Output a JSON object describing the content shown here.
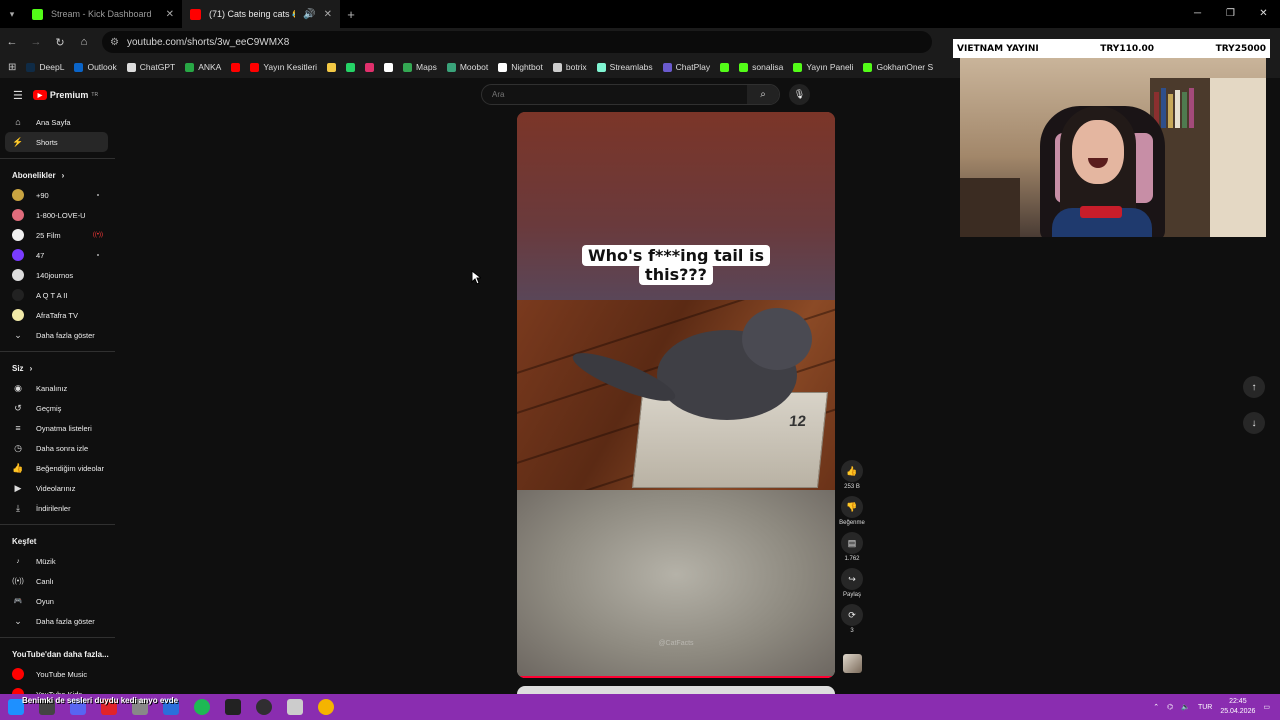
{
  "browser": {
    "tabs": [
      {
        "title": "Stream - Kick Dashboard",
        "active": false,
        "favicon_color": "#53fc18"
      },
      {
        "title": "(71) Cats being cats 😂🔥#",
        "active": true,
        "favicon_color": "#ff0000"
      }
    ],
    "new_tab": "+",
    "url": "youtube.com/shorts/3w_eeC9WMX8",
    "bookmarks": [
      {
        "label": "DeepL",
        "color": "#0f2b46"
      },
      {
        "label": "Outlook",
        "color": "#0a64c8"
      },
      {
        "label": "ChatGPT",
        "color": "#dddddd"
      },
      {
        "label": "ANKA",
        "color": "#28a745"
      },
      {
        "label": "",
        "color": "#ff0000"
      },
      {
        "label": "Yayın Kesitleri",
        "color": "#ff0000"
      },
      {
        "label": "",
        "color": "#f3c945"
      },
      {
        "label": "",
        "color": "#25d366"
      },
      {
        "label": "",
        "color": "#e1306c"
      },
      {
        "label": "",
        "color": "#ffffff"
      },
      {
        "label": "Maps",
        "color": "#34a853"
      },
      {
        "label": "Moobot",
        "color": "#3aa37a"
      },
      {
        "label": "Nightbot",
        "color": "#ffffff"
      },
      {
        "label": "botrix",
        "color": "#cccccc"
      },
      {
        "label": "Streamlabs",
        "color": "#80f5d2"
      },
      {
        "label": "ChatPlay",
        "color": "#6a5acd"
      },
      {
        "label": "",
        "color": "#53fc18"
      },
      {
        "label": "sonalisa",
        "color": "#53fc18"
      },
      {
        "label": "Yayın Paneli",
        "color": "#53fc18"
      },
      {
        "label": "GokhanOner S",
        "color": "#53fc18"
      }
    ]
  },
  "youtube": {
    "brand": "Premium",
    "brand_sup": "TR",
    "search_placeholder": "Ara",
    "main_nav": [
      {
        "label": "Ana Sayfa",
        "icon": "home-icon",
        "glyph": "⌂",
        "selected": false
      },
      {
        "label": "Shorts",
        "icon": "shorts-icon",
        "glyph": "⚡",
        "selected": true
      }
    ],
    "subscriptions_title": "Abonelikler",
    "subscriptions": [
      {
        "label": "+90",
        "color": "#c9a441",
        "indicator": "dot"
      },
      {
        "label": "1-800-LOVE-U",
        "color": "#e06c7c",
        "indicator": ""
      },
      {
        "label": "25 Film",
        "color": "#f0f0f0",
        "indicator": "live"
      },
      {
        "label": "47",
        "color": "#7a3cff",
        "indicator": "dot"
      },
      {
        "label": "140journos",
        "color": "#dddddd",
        "indicator": ""
      },
      {
        "label": "A Q T A II",
        "color": "#222222",
        "indicator": ""
      },
      {
        "label": "AfraTafra TV",
        "color": "#f1e9a8",
        "indicator": ""
      }
    ],
    "show_more": "Daha fazla göster",
    "you_title": "Siz",
    "you_items": [
      {
        "label": "Kanalınız",
        "icon": "channel-icon",
        "glyph": "◉"
      },
      {
        "label": "Geçmiş",
        "icon": "history-icon",
        "glyph": "↺"
      },
      {
        "label": "Oynatma listeleri",
        "icon": "playlists-icon",
        "glyph": "≡"
      },
      {
        "label": "Daha sonra izle",
        "icon": "watch-later-icon",
        "glyph": "◷"
      },
      {
        "label": "Beğendiğim videolar",
        "icon": "liked-icon",
        "glyph": "👍"
      },
      {
        "label": "Videolarınız",
        "icon": "your-videos-icon",
        "glyph": "▶"
      },
      {
        "label": "İndirilenler",
        "icon": "downloads-icon",
        "glyph": "⤓"
      }
    ],
    "explore_title": "Keşfet",
    "explore_items": [
      {
        "label": "Müzik",
        "icon": "music-icon",
        "glyph": "♪"
      },
      {
        "label": "Canlı",
        "icon": "live-icon",
        "glyph": "((•))"
      },
      {
        "label": "Oyun",
        "icon": "gaming-icon",
        "glyph": "🎮"
      }
    ],
    "explore_more": "Daha fazla göster",
    "more_title": "YouTube'dan daha fazla...",
    "more_items": [
      {
        "label": "YouTube Music",
        "color": "#ff0000"
      },
      {
        "label": "YouTube Kids",
        "color": "#ff0000"
      }
    ]
  },
  "short": {
    "caption_line1": "Who's f***ing tail is",
    "caption_line2": "this???",
    "box_label": "12",
    "watermark": "@CatFacts",
    "progress": 1.0,
    "likes": "253 B",
    "dislike_label": "Beğenme",
    "comments": "1.762",
    "share_label": "Paylaş",
    "remix_count": "3"
  },
  "overlay": {
    "donation_left": "VIETNAM YAYINI",
    "donation_mid": "TRY110.00",
    "donation_right": "TRY25000"
  },
  "taskbar": {
    "ticker": "Benimki de sesleri duydu kedi anyo evde",
    "language": "TUR",
    "time": "22:45",
    "date": "25.04.2026"
  }
}
